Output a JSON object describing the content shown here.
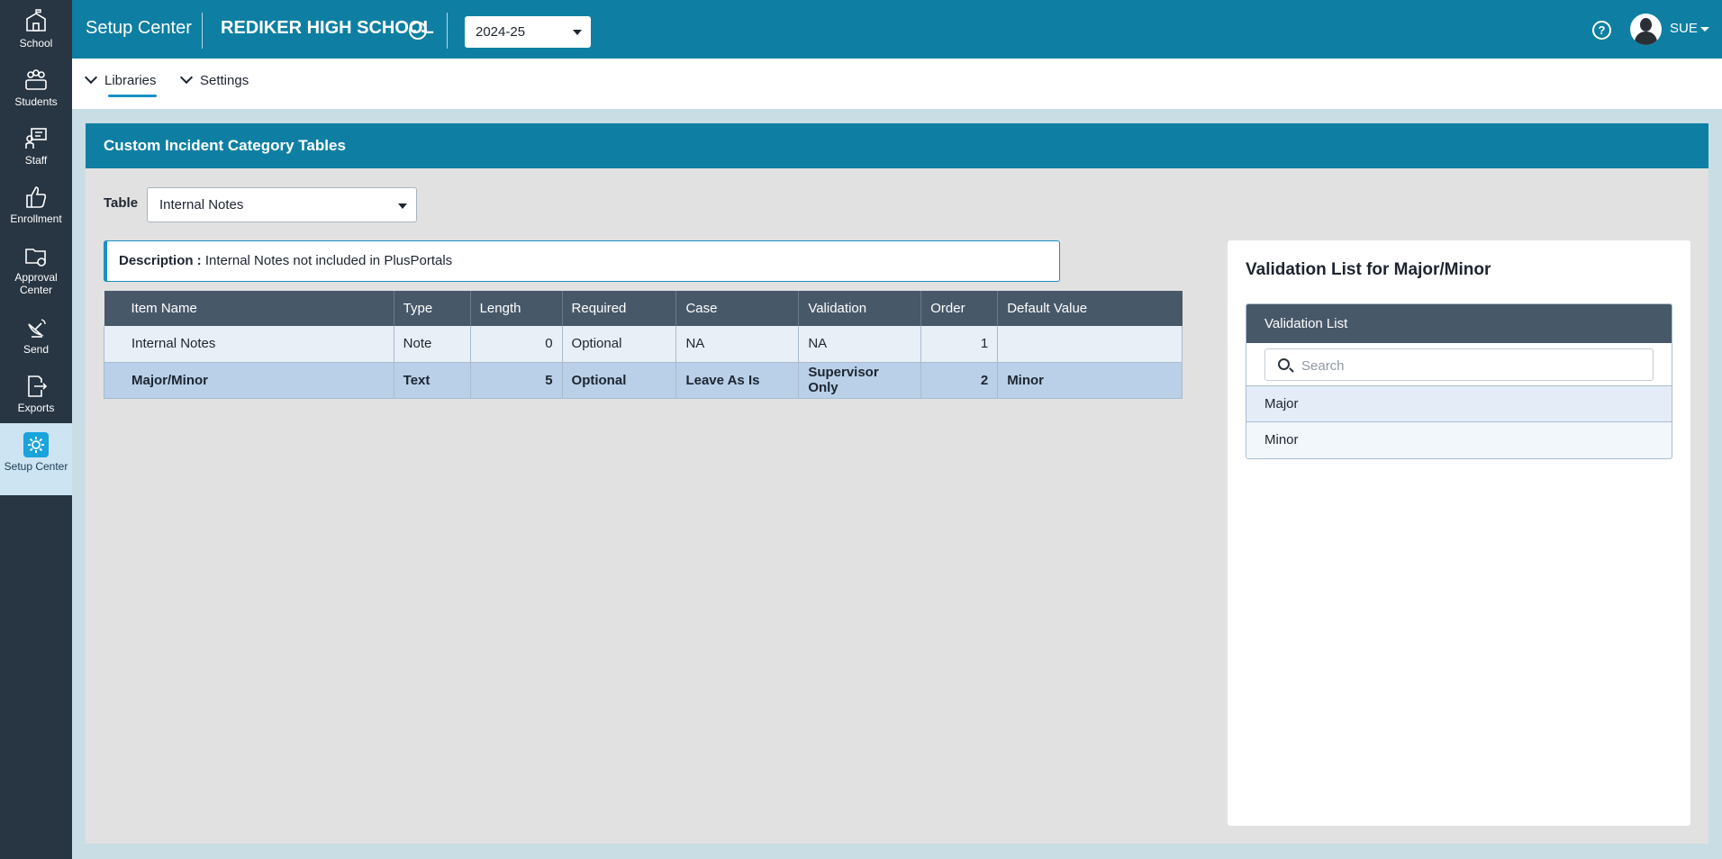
{
  "rail": {
    "items": [
      {
        "label": "School",
        "icon": "school-icon"
      },
      {
        "label": "Students",
        "icon": "students-icon"
      },
      {
        "label": "Staff",
        "icon": "staff-icon"
      },
      {
        "label": "Enrollment",
        "icon": "thumbs-up-icon"
      },
      {
        "label": "Approval Center",
        "icon": "folder-gear-icon"
      },
      {
        "label": "Send",
        "icon": "satellite-dish-icon"
      },
      {
        "label": "Exports",
        "icon": "export-file-icon"
      },
      {
        "label": "Setup Center",
        "icon": "gear-icon"
      }
    ],
    "active_index": 7
  },
  "topbar": {
    "app_title": "Setup Center",
    "school_name": "REDIKER HIGH SCHOOL",
    "year": "2024-25",
    "user": "SUE",
    "help_glyph": "?"
  },
  "subnav": {
    "items": [
      {
        "label": "Libraries",
        "active": true
      },
      {
        "label": "Settings",
        "active": false
      }
    ]
  },
  "panel": {
    "title": "Custom Incident Category Tables",
    "table_label": "Table",
    "table_value": "Internal Notes",
    "description_label": "Description :",
    "description_text": "Internal Notes not included in PlusPortals"
  },
  "grid": {
    "headers": [
      "Item Name",
      "Type",
      "Length",
      "Required",
      "Case",
      "Validation",
      "Order",
      "Default Value"
    ],
    "rows": [
      {
        "item_name": "Internal Notes",
        "type": "Note",
        "length": "0",
        "required": "Optional",
        "case": "NA",
        "validation": "NA",
        "order": "1",
        "default_value": ""
      },
      {
        "item_name": "Major/Minor",
        "type": "Text",
        "length": "5",
        "required": "Optional",
        "case": "Leave As Is",
        "validation": "Supervisor Only",
        "order": "2",
        "default_value": "Minor"
      }
    ],
    "selected_row": 1
  },
  "validation": {
    "title": "Validation List for Major/Minor",
    "list_header": "Validation List",
    "search_placeholder": "Search",
    "items": [
      "Major",
      "Minor"
    ]
  },
  "colors": {
    "accent": "#0e7fa3",
    "rail_bg": "#283542",
    "table_header_bg": "#475869",
    "selected_row_bg": "#b9d0e8"
  }
}
